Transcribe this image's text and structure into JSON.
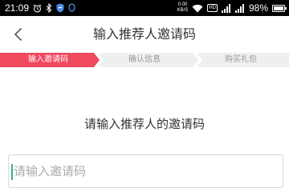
{
  "status_bar": {
    "time": "21:09",
    "speed_value": "0.00",
    "speed_unit": "KB/S",
    "hd_label": "HD",
    "battery_percent": "98%",
    "battery_level": 0.98
  },
  "nav": {
    "title": "输入推荐人邀请码"
  },
  "steps": [
    {
      "label": "输入邀请码",
      "active": true
    },
    {
      "label": "确认信息",
      "active": false
    },
    {
      "label": "购买礼包",
      "active": false
    }
  ],
  "colors": {
    "accent": "#f0485f",
    "step_inactive": "#efefef",
    "caret": "#2fb59c"
  },
  "main": {
    "prompt": "请输入推荐人的邀请码",
    "input_placeholder": "请输入邀请码",
    "input_value": ""
  }
}
